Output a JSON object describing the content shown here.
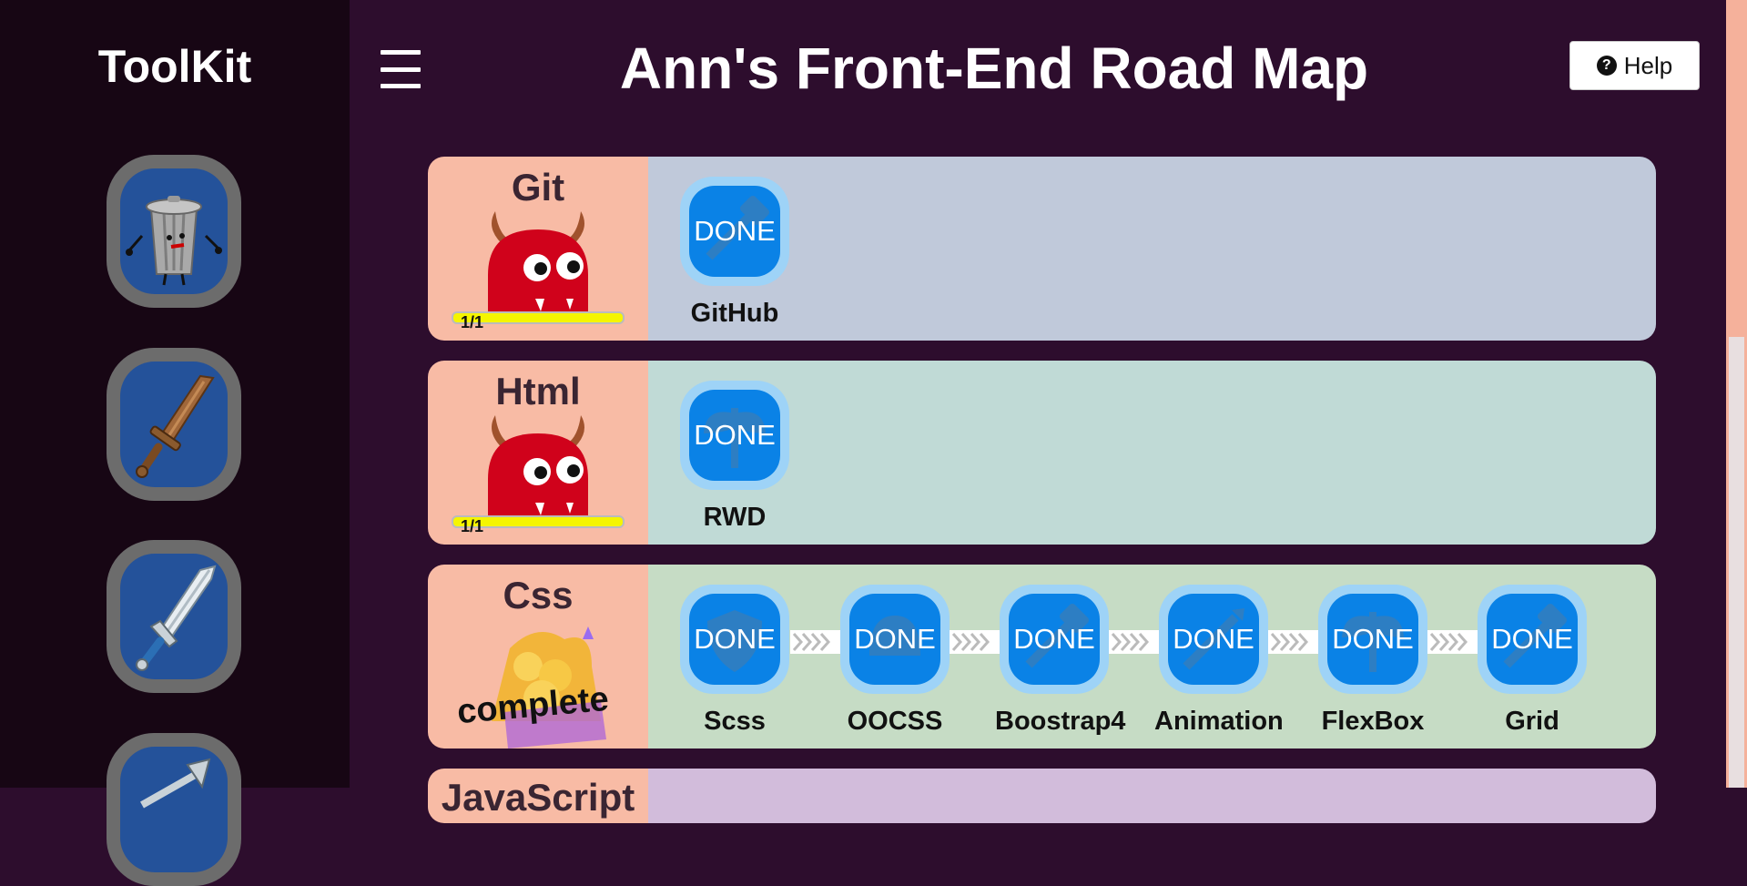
{
  "sidebar": {
    "title": "ToolKit",
    "tools": [
      {
        "icon": "trash-can-icon"
      },
      {
        "icon": "wooden-sword-icon"
      },
      {
        "icon": "steel-sword-icon"
      },
      {
        "icon": "axe-icon"
      }
    ]
  },
  "header": {
    "menu_icon": "hamburger-menu-icon",
    "title": "Ann's Front-End Road Map",
    "help_label": "Help",
    "help_icon": "question-circle-icon",
    "help_glyph": "?"
  },
  "rows": [
    {
      "title": "Git",
      "progress_text": "1/1",
      "progress": 1.0,
      "bg": "#c0c9da",
      "skills": [
        {
          "status": "DONE",
          "label": "GitHub"
        }
      ]
    },
    {
      "title": "Html",
      "progress_text": "1/1",
      "progress": 1.0,
      "bg": "#c0dad6",
      "skills": [
        {
          "status": "DONE",
          "label": "RWD"
        }
      ]
    },
    {
      "title": "Css",
      "complete_text": "complete",
      "bg": "#c6dcc5",
      "skills": [
        {
          "status": "DONE",
          "label": "Scss"
        },
        {
          "status": "DONE",
          "label": "OOCSS"
        },
        {
          "status": "DONE",
          "label": "Boostrap4"
        },
        {
          "status": "DONE",
          "label": "Animation"
        },
        {
          "status": "DONE",
          "label": "FlexBox"
        },
        {
          "status": "DONE",
          "label": "Grid"
        }
      ]
    },
    {
      "title": "JavaScript",
      "bg": "#d2bcdb"
    }
  ],
  "colors": {
    "page_bg": "#2d0d2d",
    "sidebar_bg": "#170614",
    "row_head_bg": "#f8bba5",
    "skill_blue": "#0a82e6",
    "progress_fill": "#f5f500"
  }
}
